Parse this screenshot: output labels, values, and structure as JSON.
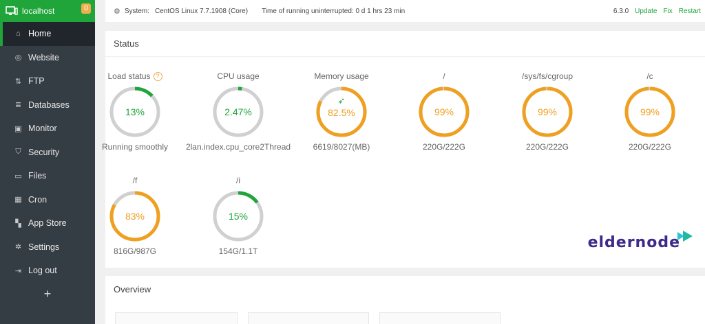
{
  "sidebar": {
    "host": "localhost",
    "badge": "0",
    "items": [
      {
        "label": "Home",
        "icon": "home-icon",
        "active": true
      },
      {
        "label": "Website",
        "icon": "globe-icon"
      },
      {
        "label": "FTP",
        "icon": "ftp-icon"
      },
      {
        "label": "Databases",
        "icon": "database-icon"
      },
      {
        "label": "Monitor",
        "icon": "monitor-icon"
      },
      {
        "label": "Security",
        "icon": "shield-icon"
      },
      {
        "label": "Files",
        "icon": "folder-icon"
      },
      {
        "label": "Cron",
        "icon": "calendar-icon"
      },
      {
        "label": "App Store",
        "icon": "grid-icon"
      },
      {
        "label": "Settings",
        "icon": "gear-icon"
      },
      {
        "label": "Log out",
        "icon": "logout-icon"
      }
    ],
    "add": "+"
  },
  "topbar": {
    "system_label": "System:",
    "system_value": "CentOS Linux 7.7.1908 (Core)",
    "uptime": "Time of running uninterrupted: 0 d 1 hrs 23 min",
    "version": "6.3.0",
    "update": "Update",
    "fix": "Fix",
    "restart": "Restart"
  },
  "status": {
    "title": "Status",
    "gauges": [
      {
        "title": "Load status",
        "value": "13%",
        "percent": 13,
        "sub": "Running smoothly",
        "color": "#20a53a",
        "help": "?"
      },
      {
        "title": "CPU usage",
        "value": "2.47%",
        "percent": 2.47,
        "sub": "2lan.index.cpu_core2Thread",
        "color": "#20a53a"
      },
      {
        "title": "Memory usage",
        "value": "82.5%",
        "percent": 82.5,
        "sub": "6619/8027(MB)",
        "color": "#f0a020",
        "rocket": true
      },
      {
        "title": "/",
        "value": "99%",
        "percent": 99,
        "sub": "220G/222G",
        "color": "#f0a020"
      },
      {
        "title": "/sys/fs/cgroup",
        "value": "99%",
        "percent": 99,
        "sub": "220G/222G",
        "color": "#f0a020"
      },
      {
        "title": "/c",
        "value": "99%",
        "percent": 99,
        "sub": "220G/222G",
        "color": "#f0a020"
      },
      {
        "title": "/f",
        "value": "83%",
        "percent": 83,
        "sub": "816G/987G",
        "color": "#f0a020"
      },
      {
        "title": "/i",
        "value": "15%",
        "percent": 15,
        "sub": "154G/1.1T",
        "color": "#20a53a"
      }
    ]
  },
  "logo": {
    "text_a": "elder",
    "text_b": "node"
  },
  "overview": {
    "title": "Overview"
  }
}
